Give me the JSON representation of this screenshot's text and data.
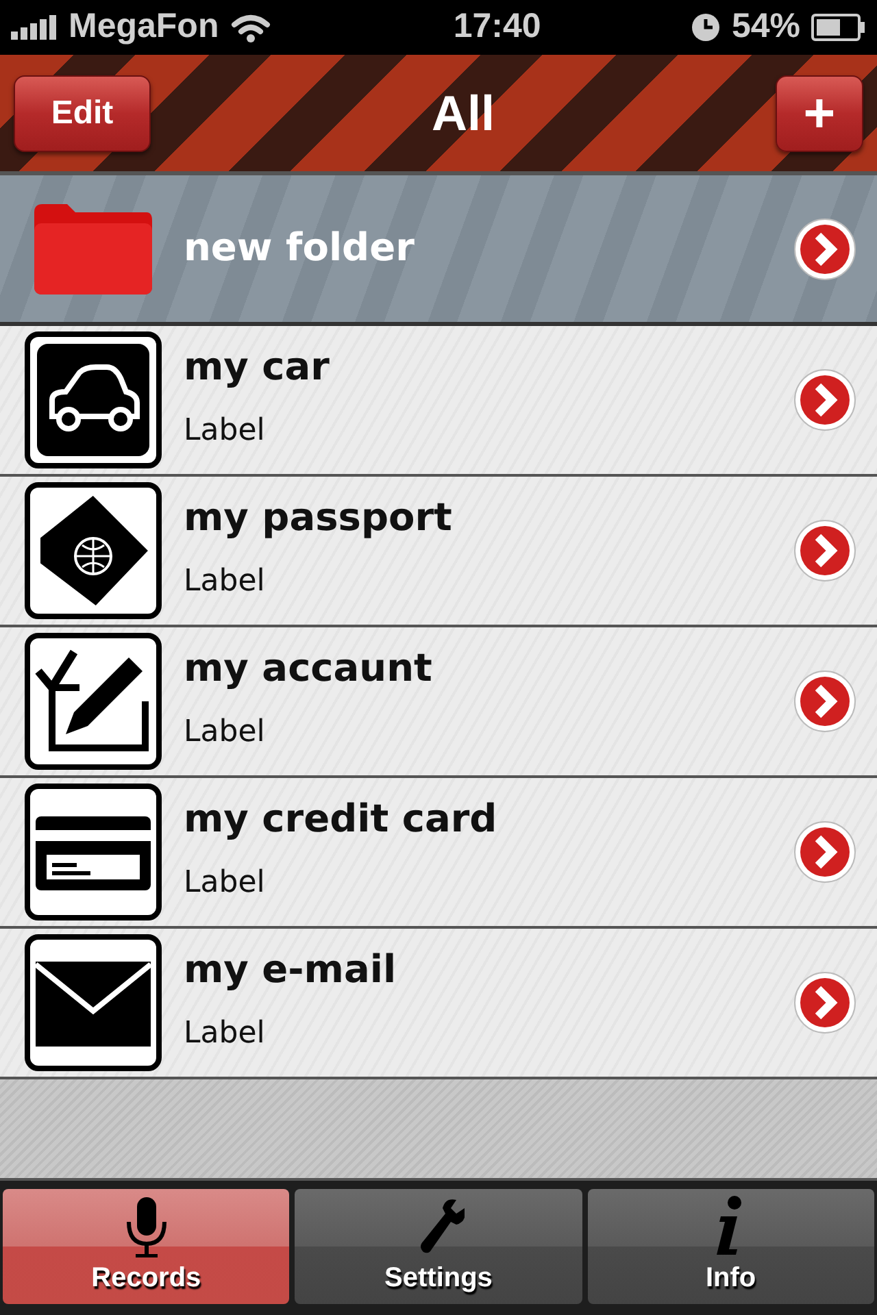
{
  "status_bar": {
    "carrier": "MegaFon",
    "time": "17:40",
    "battery": "54%"
  },
  "nav_bar": {
    "title": "All",
    "left_button": "Edit",
    "right_button": "+"
  },
  "rows": [
    {
      "kind": "folder",
      "title": "new folder"
    },
    {
      "kind": "car",
      "title": "my car",
      "subtitle": "Label"
    },
    {
      "kind": "passport",
      "title": "my passport",
      "subtitle": "Label"
    },
    {
      "kind": "account",
      "title": "my accaunt",
      "subtitle": "Label"
    },
    {
      "kind": "card",
      "title": "my credit card",
      "subtitle": "Label"
    },
    {
      "kind": "mail",
      "title": "my e-mail",
      "subtitle": "Label"
    }
  ],
  "tabs": [
    {
      "kind": "mic",
      "label": "Records",
      "selected": true
    },
    {
      "kind": "wrench",
      "label": "Settings",
      "selected": false
    },
    {
      "kind": "info",
      "label": "Info",
      "selected": false
    }
  ]
}
